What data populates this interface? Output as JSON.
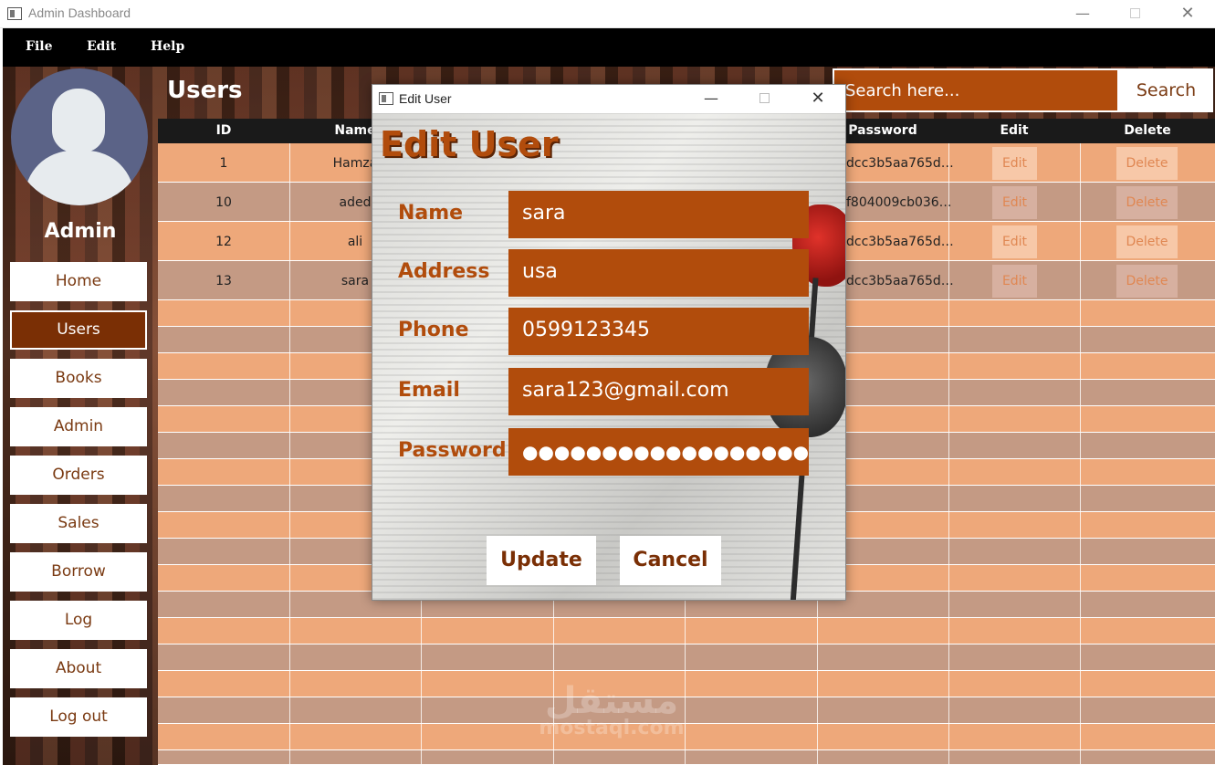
{
  "window": {
    "title": "Admin Dashboard"
  },
  "menu": [
    "File",
    "Edit",
    "Help"
  ],
  "sidebar": {
    "admin_name": "Admin",
    "items": [
      {
        "label": "Home",
        "active": false
      },
      {
        "label": "Users",
        "active": true
      },
      {
        "label": "Books",
        "active": false
      },
      {
        "label": "Admin",
        "active": false
      },
      {
        "label": "Orders",
        "active": false
      },
      {
        "label": "Sales",
        "active": false
      },
      {
        "label": "Borrow",
        "active": false
      },
      {
        "label": "Log",
        "active": false
      },
      {
        "label": "About",
        "active": false
      },
      {
        "label": "Log out",
        "active": false
      }
    ]
  },
  "page_title": "Users",
  "search": {
    "placeholder": "Search here...",
    "button": "Search"
  },
  "table": {
    "headers": [
      "ID",
      "Name",
      "Password",
      "Edit",
      "Delete"
    ],
    "rows": [
      {
        "id": "1",
        "name": "Hamza",
        "password": "dcc3b5aa765d…",
        "edit": "Edit",
        "delete": "Delete"
      },
      {
        "id": "10",
        "name": "aded",
        "password": "f804009cb036…",
        "edit": "Edit",
        "delete": "Delete"
      },
      {
        "id": "12",
        "name": "ali",
        "password": "dcc3b5aa765d…",
        "edit": "Edit",
        "delete": "Delete"
      },
      {
        "id": "13",
        "name": "sara",
        "password": "dcc3b5aa765d…",
        "edit": "Edit",
        "delete": "Delete"
      }
    ]
  },
  "watermark": {
    "arabic": "مستقل",
    "latin": "mostaql.com"
  },
  "dialog": {
    "title": "Edit User",
    "heading": "Edit User",
    "fields": [
      {
        "label": "Name",
        "value": "sara"
      },
      {
        "label": "Address",
        "value": "usa"
      },
      {
        "label": "Phone",
        "value": "0599123345"
      },
      {
        "label": "Email",
        "value": "sara123@gmail.com"
      },
      {
        "label": "Password",
        "value": "●●●●●●●●●●●●●●●●●●●●"
      }
    ],
    "update": "Update",
    "cancel": "Cancel"
  },
  "colors": {
    "accent": "#b14c0c",
    "active_nav": "#7a2f05",
    "row_light": "#eea87a",
    "row_dark": "#c49a84",
    "header": "#1a1a1a"
  },
  "icons": {
    "app": "window-icon",
    "minimize": "minimize-icon",
    "maximize": "maximize-icon",
    "close": "close-icon"
  }
}
